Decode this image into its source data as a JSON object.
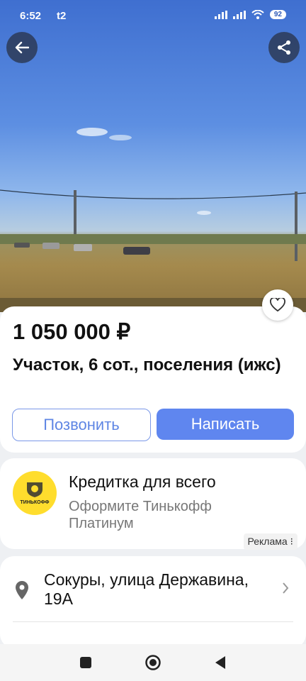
{
  "status": {
    "time": "6:52",
    "carrier": "t2",
    "battery": "92"
  },
  "listing": {
    "price": "1 050 000 ₽",
    "title": "Участок, 6 сот., поселения (ижс)",
    "call_label": "Позвонить",
    "write_label": "Написать"
  },
  "ad": {
    "logo_text": "ТИНЬКОФФ",
    "title": "Кредитка для всего",
    "subtitle": "Оформите Тинькофф Платинум",
    "label": "Реклама ⁝"
  },
  "address": {
    "text": "Сокуры, улица Державина, 19А"
  },
  "colors": {
    "accent": "#5f86ef",
    "brand_yellow": "#ffdd2d"
  }
}
